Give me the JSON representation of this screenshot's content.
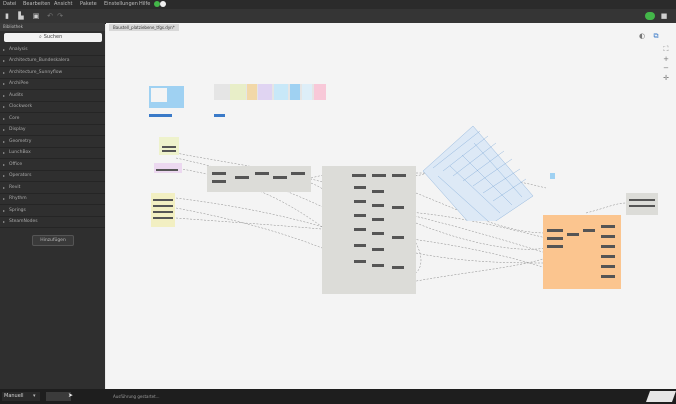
{
  "menu": [
    "Datei",
    "Bearbeiten",
    "Ansicht",
    "Pakete",
    "Einstellungen",
    "Hilfe"
  ],
  "sidebar": {
    "header": "Bibliothek",
    "search_placeholder": "Suchen",
    "items": [
      {
        "label": "Analysis"
      },
      {
        "label": "Architecture_Bundeskalera"
      },
      {
        "label": "Architecture_Sunnyflow"
      },
      {
        "label": "ArchiPee"
      },
      {
        "label": "Audits"
      },
      {
        "label": "Clockwork"
      },
      {
        "label": "Core"
      },
      {
        "label": "Display"
      },
      {
        "label": "Geometry"
      },
      {
        "label": "LunchBox"
      },
      {
        "label": "Office"
      },
      {
        "label": "Operators"
      },
      {
        "label": "Revit"
      },
      {
        "label": "Rhythm"
      },
      {
        "label": "Springs"
      },
      {
        "label": "SteamNodes"
      }
    ],
    "add_button": "Hinzufügen"
  },
  "canvas": {
    "tab_title": "Baustell_platziebene_tfgs.dyn*"
  },
  "status": {
    "run_mode": "Manuell",
    "message": "Ausführung gestartet..."
  },
  "colors": {
    "accent_green": "#43b649",
    "node_blue": "#9fd1f2",
    "group_orange": "#fbc58f",
    "group_yellow": "#f2f2c2",
    "group_gray": "#dcdcd8"
  }
}
